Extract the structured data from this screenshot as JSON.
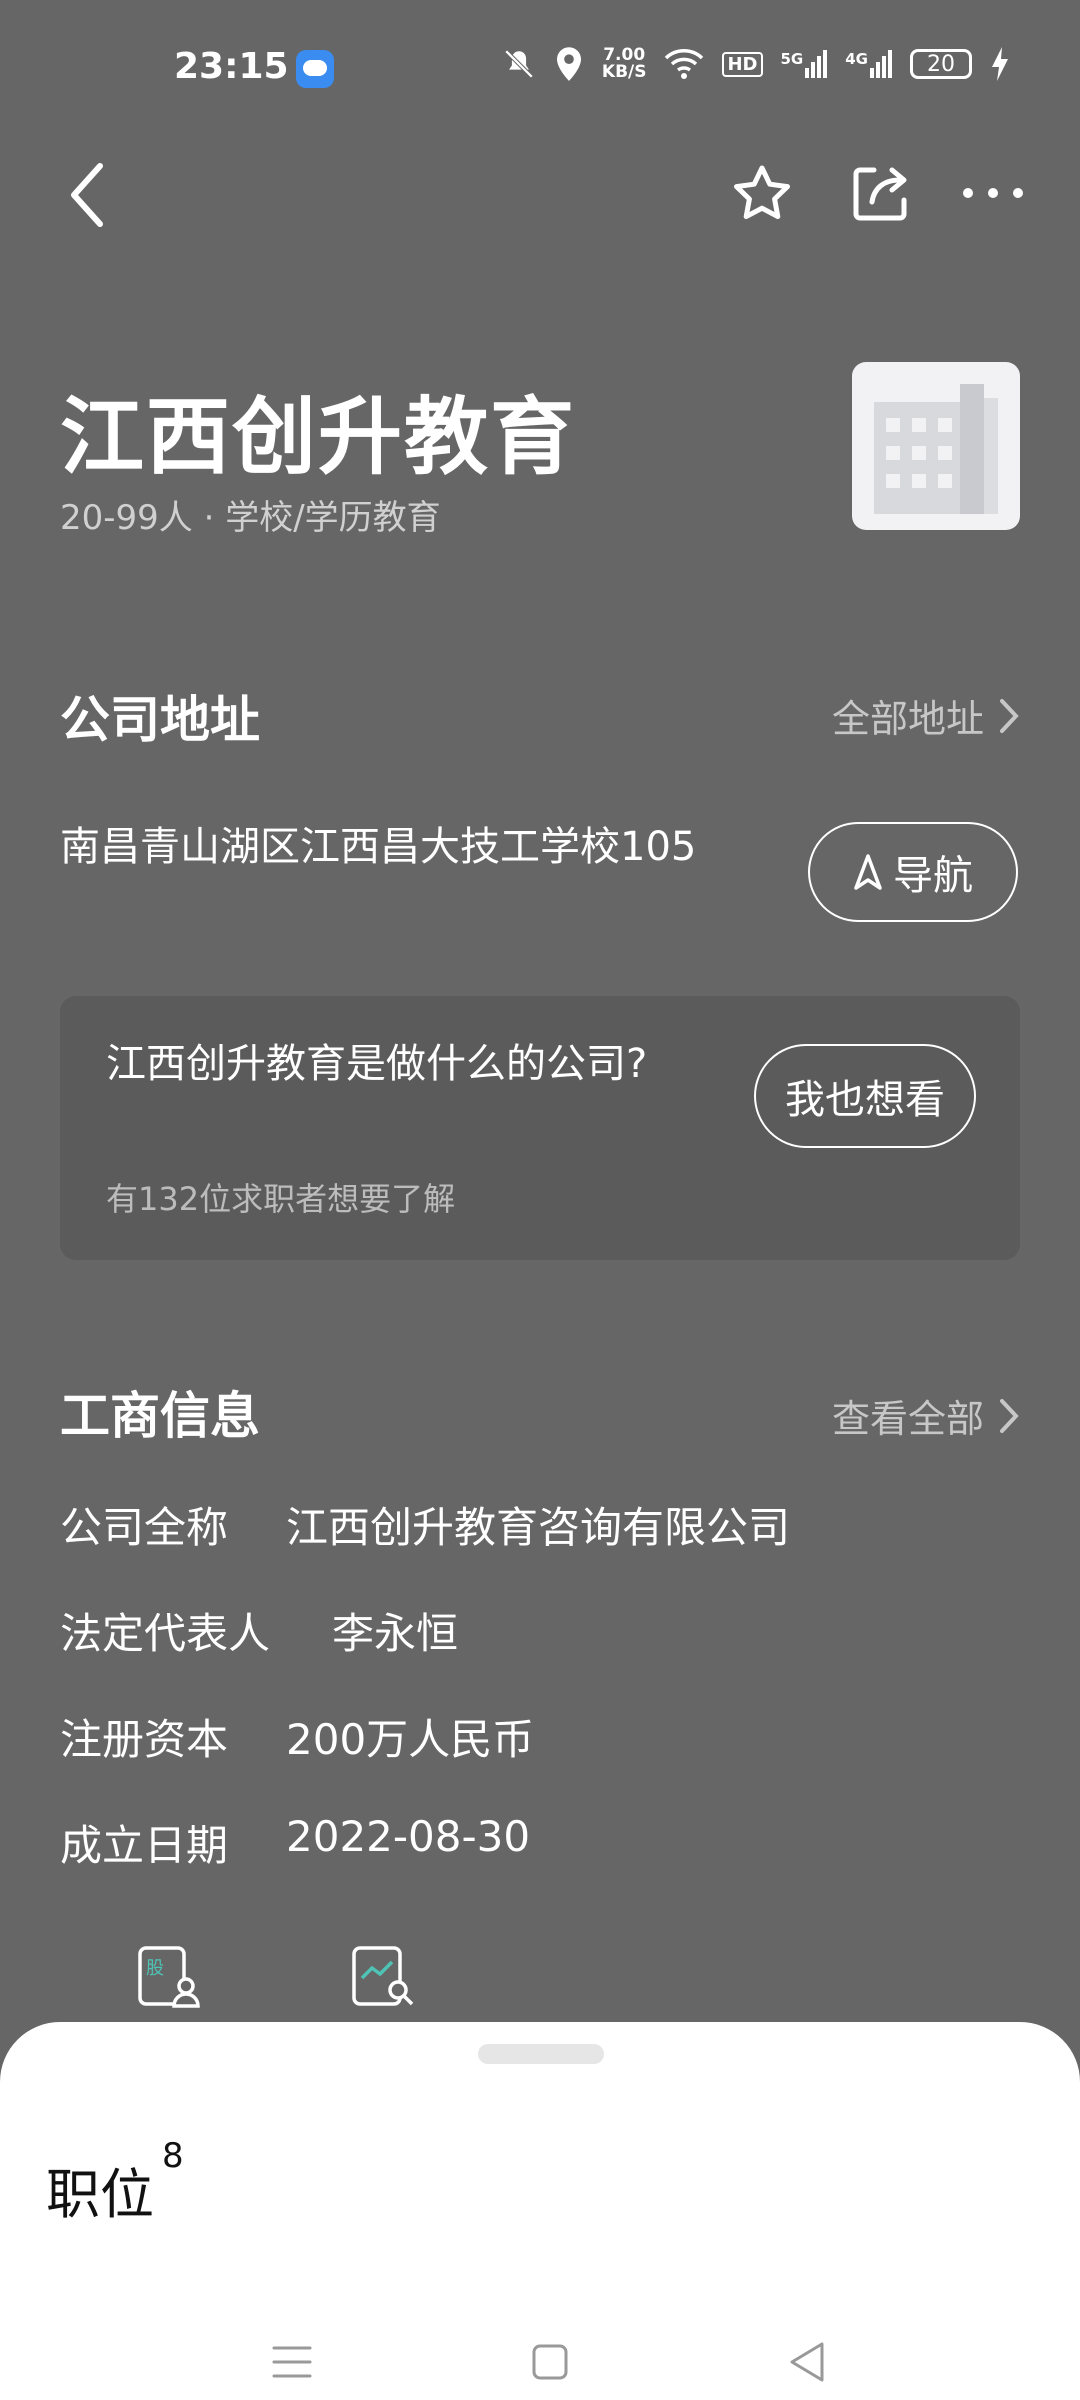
{
  "status_bar": {
    "time": "23:15",
    "network_speed": "7.00\nKB/S",
    "signal_5g": "5G",
    "signal_4g": "4G",
    "hd": "HD",
    "battery": "20"
  },
  "company": {
    "name": "江西创升教育",
    "meta": "20-99人 · 学校/学历教育"
  },
  "address_section": {
    "title": "公司地址",
    "more_label": "全部地址",
    "address": "南昌青山湖区江西昌大技工学校105",
    "nav_label": "导航"
  },
  "question_card": {
    "question": "江西创升教育是做什么的公司?",
    "sub": "有132位求职者想要了解",
    "button": "我也想看"
  },
  "business_info": {
    "title": "工商信息",
    "more_label": "查看全部",
    "rows": [
      {
        "label": "公司全称",
        "value": "江西创升教育咨询有限公司"
      },
      {
        "label": "法定代表人",
        "value": "李永恒"
      },
      {
        "label": "注册资本",
        "value": "200万人民币"
      },
      {
        "label": "成立日期",
        "value": "2022-08-30"
      }
    ],
    "tool_icons": [
      "shareholder-icon",
      "trend-search-icon"
    ]
  },
  "jobs_sheet": {
    "title": "职位",
    "count": "8"
  },
  "colors": {
    "background": "#666666",
    "card": "#5b5b5b",
    "accent_teal": "#4fc3b6"
  }
}
